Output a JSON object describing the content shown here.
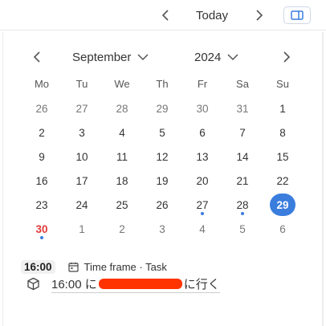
{
  "toolbar": {
    "today_label": "Today",
    "prev_icon": "chevron-left-icon",
    "next_icon": "chevron-right-icon",
    "panel_icon": "sidebar-toggle-icon"
  },
  "calendar": {
    "month": "September",
    "year": "2024",
    "weekdays": [
      "Mo",
      "Tu",
      "We",
      "Th",
      "Fr",
      "Sa",
      "Su"
    ],
    "weeks": [
      [
        {
          "d": "26",
          "muted": true
        },
        {
          "d": "27",
          "muted": true
        },
        {
          "d": "28",
          "muted": true
        },
        {
          "d": "29",
          "muted": true
        },
        {
          "d": "30",
          "muted": true
        },
        {
          "d": "31",
          "muted": true
        },
        {
          "d": "1"
        }
      ],
      [
        {
          "d": "2"
        },
        {
          "d": "3"
        },
        {
          "d": "4"
        },
        {
          "d": "5"
        },
        {
          "d": "6"
        },
        {
          "d": "7"
        },
        {
          "d": "8"
        }
      ],
      [
        {
          "d": "9"
        },
        {
          "d": "10"
        },
        {
          "d": "11"
        },
        {
          "d": "12"
        },
        {
          "d": "13"
        },
        {
          "d": "14"
        },
        {
          "d": "15"
        }
      ],
      [
        {
          "d": "16"
        },
        {
          "d": "17"
        },
        {
          "d": "18"
        },
        {
          "d": "19"
        },
        {
          "d": "20"
        },
        {
          "d": "21"
        },
        {
          "d": "22"
        }
      ],
      [
        {
          "d": "23"
        },
        {
          "d": "24"
        },
        {
          "d": "25"
        },
        {
          "d": "26"
        },
        {
          "d": "27",
          "dot": true
        },
        {
          "d": "28",
          "dot": true
        },
        {
          "d": "29",
          "selected": true
        }
      ],
      [
        {
          "d": "30",
          "red": true,
          "dot": true
        },
        {
          "d": "1",
          "muted": true
        },
        {
          "d": "2",
          "muted": true
        },
        {
          "d": "3",
          "muted": true
        },
        {
          "d": "4",
          "muted": true
        },
        {
          "d": "5",
          "muted": true
        },
        {
          "d": "6",
          "muted": true
        }
      ]
    ]
  },
  "event": {
    "time": "16:00",
    "type_label": "Time frame · Task",
    "title_prefix": "16:00 に",
    "title_suffix": "に行く"
  },
  "colors": {
    "accent": "#3b7ddd",
    "today_red": "#e03a3a",
    "redaction": "#ff3300"
  }
}
